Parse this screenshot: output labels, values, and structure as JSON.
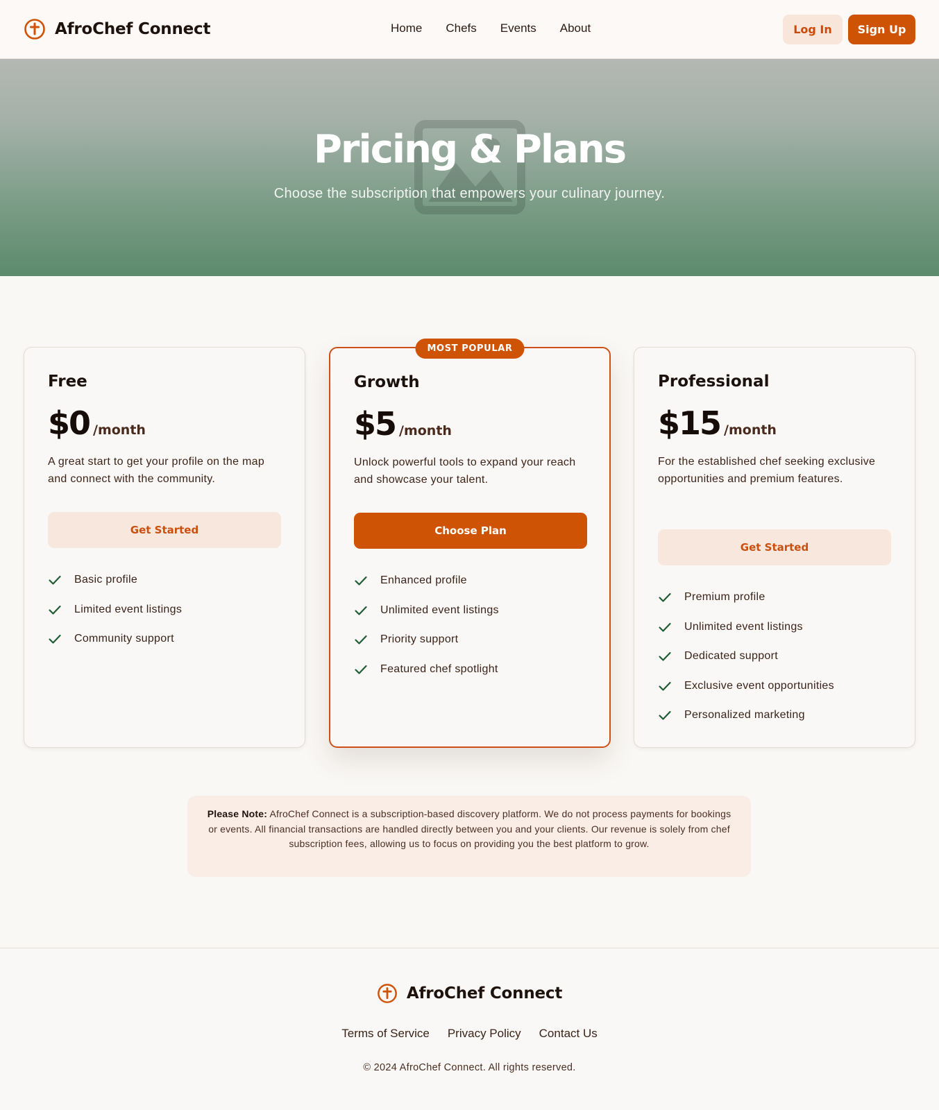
{
  "header": {
    "brand_name": "AfroChef Connect",
    "brand_icon": "chef-logo-icon",
    "nav": [
      "Home",
      "Chefs",
      "Events",
      "About"
    ],
    "login_label": "Log In",
    "signup_label": "Sign Up"
  },
  "hero": {
    "title": "Pricing & Plans",
    "subtitle": "Choose the subscription that empowers your culinary journey.",
    "background_icon": "image-placeholder-icon"
  },
  "plans": [
    {
      "name": "Free",
      "price": "$0",
      "period": "/month",
      "description": "A great start to get your profile on the map and connect with the community.",
      "cta": "Get Started",
      "features": [
        "Basic profile",
        "Limited event listings",
        "Community support"
      ]
    },
    {
      "name": "Growth",
      "badge": "MOST POPULAR",
      "price": "$5",
      "period": "/month",
      "description": "Unlock powerful tools to expand your reach and showcase your talent.",
      "cta": "Choose Plan",
      "features": [
        "Enhanced profile",
        "Unlimited event listings",
        "Priority support",
        "Featured chef spotlight"
      ]
    },
    {
      "name": "Professional",
      "price": "$15",
      "period": "/month",
      "description": "For the established chef seeking exclusive opportunities and premium features.",
      "cta": "Get Started",
      "features": [
        "Premium profile",
        "Unlimited event listings",
        "Dedicated support",
        "Exclusive event opportunities",
        "Personalized marketing"
      ]
    }
  ],
  "note": {
    "label": "Please Note:",
    "text": "AfroChef Connect is a subscription-based discovery platform. We do not process payments for bookings or events. All financial transactions are handled directly between you and your clients. Our revenue is solely from chef subscription fees, allowing us to focus on providing you the best platform to grow."
  },
  "footer": {
    "brand_name": "AfroChef Connect",
    "links": [
      "Terms of Service",
      "Privacy Policy",
      "Contact Us"
    ],
    "copyright": "© 2024 AfroChef Connect. All rights reserved."
  },
  "colors": {
    "accent": "#cf5304",
    "accent_light": "#f8e7dc",
    "check": "#1f5c34",
    "hero_green": "#5c8a6c"
  }
}
